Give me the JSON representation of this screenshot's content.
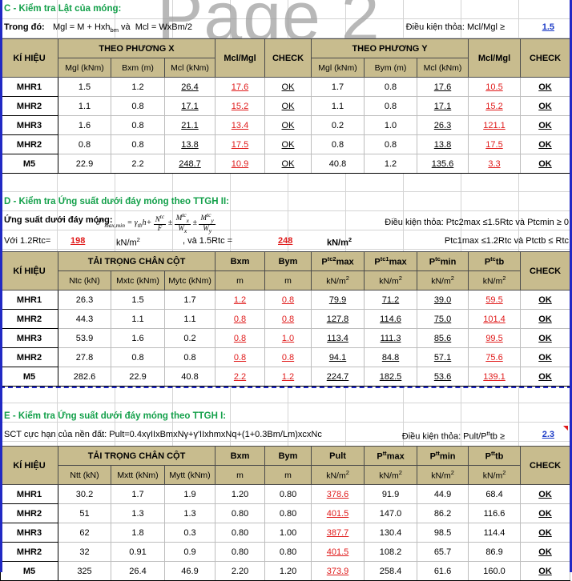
{
  "watermark": "Page 2",
  "colors": {
    "header_fill": "#c8bc8e",
    "section_title": "#13a04a",
    "value_blue": "#1a39c6",
    "highlight_red": "#e01b1b",
    "frame_blue": "#2129c4"
  },
  "sections": [
    {
      "id": "C",
      "title": "C - Kiểm tra Lật của móng:",
      "note_label": "Trong đó:",
      "note_text": "Mgl = M + Hxhbm và  Mcl = WxBm/2",
      "condition": "Điều kiện thỏa: Mcl/Mgl ≥",
      "condition_value": "1.5",
      "has_comment_marker": false,
      "header": {
        "first_col": "KÍ HIỆU",
        "groups": [
          {
            "label": "THEO PHƯƠNG X",
            "cols": [
              "Mgl (kNm)",
              "Bxm (m)",
              "Mcl (kNm)"
            ]
          },
          {
            "label": "Mcl/Mgl",
            "cols": []
          },
          {
            "label": "CHECK",
            "cols": []
          },
          {
            "label": "THEO PHƯƠNG Y",
            "cols": [
              "Mgl (kNm)",
              "Bym (m)",
              "Mcl (kNm)"
            ]
          },
          {
            "label": "Mcl/Mgl",
            "cols": []
          },
          {
            "label": "CHECK",
            "cols": []
          }
        ]
      },
      "rows": [
        {
          "label": "MHR1",
          "cells": [
            "1.5",
            "1.2",
            "26.4",
            "17.6",
            "OK",
            "1.7",
            "0.8",
            "17.6",
            "10.5",
            "OK"
          ]
        },
        {
          "label": "MHR2",
          "cells": [
            "1.1",
            "0.8",
            "17.1",
            "15.2",
            "OK",
            "1.1",
            "0.8",
            "17.1",
            "15.2",
            "OK"
          ]
        },
        {
          "label": "MHR3",
          "cells": [
            "1.6",
            "0.8",
            "21.1",
            "13.4",
            "OK",
            "0.2",
            "1.0",
            "26.3",
            "121.1",
            "OK"
          ]
        },
        {
          "label": "MHR2",
          "cells": [
            "0.8",
            "0.8",
            "13.8",
            "17.5",
            "OK",
            "0.8",
            "0.8",
            "13.8",
            "17.5",
            "OK"
          ]
        },
        {
          "label": "M5",
          "cells": [
            "22.9",
            "2.2",
            "248.7",
            "10.9",
            "OK",
            "40.8",
            "1.2",
            "135.6",
            "3.3",
            "OK"
          ]
        }
      ]
    },
    {
      "id": "D",
      "title": "D - Kiểm tra Ứng suất dưới đáy móng theo TTGH II:",
      "note_label": "Ứng suất dưới đáy móng:",
      "formula": "σtc max,min = γtb·h + Ntc/F ± Mtc x/Wx ± Mtc y/Wy",
      "condition": "Điều kiện thỏa: Ptc2max ≤1.5Rtc và Ptcmin ≥ 0",
      "condition2": "Ptc1max ≤1.2Rtc và Ptctb ≤ Rtc",
      "rtc_line": {
        "label1": "Với 1.2Rtc=",
        "value1": "198",
        "unit1": "kN/m2",
        "label2": ", và 1.5Rtc =",
        "value2": "248",
        "unit2": "kN/m2"
      },
      "header": {
        "first_col": "KÍ HIỆU",
        "group_label": "TẢI TRỌNG CHÂN CỘT",
        "group_cols": [
          "Ntc (kN)",
          "Mxtc (kNm)",
          "Mytc (kNm)"
        ],
        "cols": [
          {
            "top": "Bxm",
            "bot": "m"
          },
          {
            "top": "Bym",
            "bot": "m"
          },
          {
            "top": "Ptc2max",
            "bot": "kN/m2"
          },
          {
            "top": "Ptc1max",
            "bot": "kN/m2"
          },
          {
            "top": "Ptcmin",
            "bot": "kN/m2"
          },
          {
            "top": "Ptctb",
            "bot": "kN/m2"
          }
        ],
        "check_col": "CHECK"
      },
      "rows": [
        {
          "label": "MHR1",
          "cells": [
            "26.3",
            "1.5",
            "1.7",
            "1.2",
            "0.8",
            "79.9",
            "71.2",
            "39.0",
            "59.5",
            "OK"
          ]
        },
        {
          "label": "MHR2",
          "cells": [
            "44.3",
            "1.1",
            "1.1",
            "0.8",
            "0.8",
            "127.8",
            "114.6",
            "75.0",
            "101.4",
            "OK"
          ]
        },
        {
          "label": "MHR3",
          "cells": [
            "53.9",
            "1.6",
            "0.2",
            "0.8",
            "1.0",
            "113.4",
            "111.3",
            "85.6",
            "99.5",
            "OK"
          ]
        },
        {
          "label": "MHR2",
          "cells": [
            "27.8",
            "0.8",
            "0.8",
            "0.8",
            "0.8",
            "94.1",
            "84.8",
            "57.1",
            "75.6",
            "OK"
          ]
        },
        {
          "label": "M5",
          "cells": [
            "282.6",
            "22.9",
            "40.8",
            "2.2",
            "1.2",
            "224.7",
            "182.5",
            "53.6",
            "139.1",
            "OK"
          ]
        }
      ]
    },
    {
      "id": "E",
      "title": "E - Kiểm tra Ứng suất dưới đáy móng theo TTGH I:",
      "note_text": "SCT cực hạn của nền đất: Pult=0.4xγIIxBmxNγ+γ'IIxhmxNq+(1+0.3Bm/Lm)xcxNc",
      "condition": "Điều kiện thỏa: Pult/Pttb ≥",
      "condition_value": "2.3",
      "has_comment_marker": true,
      "header": {
        "first_col": "KÍ HIỆU",
        "group_label": "TẢI TRỌNG CHÂN CỘT",
        "group_cols": [
          "Ntt (kN)",
          "Mxtt (kNm)",
          "Mytt (kNm)"
        ],
        "cols": [
          {
            "top": "Bxm",
            "bot": "m"
          },
          {
            "top": "Bym",
            "bot": "m"
          },
          {
            "top": "Pult",
            "bot": "kN/m2"
          },
          {
            "top": "Pttmax",
            "bot": "kN/m2"
          },
          {
            "top": "Pttmin",
            "bot": "kN/m2"
          },
          {
            "top": "Ptttb",
            "bot": "kN/m2"
          }
        ],
        "check_col": "CHECK"
      },
      "rows": [
        {
          "label": "MHR1",
          "cells": [
            "30.2",
            "1.7",
            "1.9",
            "1.20",
            "0.80",
            "378.6",
            "91.9",
            "44.9",
            "68.4",
            "OK"
          ]
        },
        {
          "label": "MHR2",
          "cells": [
            "51",
            "1.3",
            "1.3",
            "0.80",
            "0.80",
            "401.5",
            "147.0",
            "86.2",
            "116.6",
            "OK"
          ]
        },
        {
          "label": "MHR3",
          "cells": [
            "62",
            "1.8",
            "0.3",
            "0.80",
            "1.00",
            "387.7",
            "130.4",
            "98.5",
            "114.4",
            "OK"
          ]
        },
        {
          "label": "MHR2",
          "cells": [
            "32",
            "0.91",
            "0.9",
            "0.80",
            "0.80",
            "401.5",
            "108.2",
            "65.7",
            "86.9",
            "OK"
          ]
        },
        {
          "label": "M5",
          "cells": [
            "325",
            "26.4",
            "46.9",
            "2.20",
            "1.20",
            "373.9",
            "258.4",
            "61.6",
            "160.0",
            "OK"
          ]
        }
      ]
    }
  ]
}
